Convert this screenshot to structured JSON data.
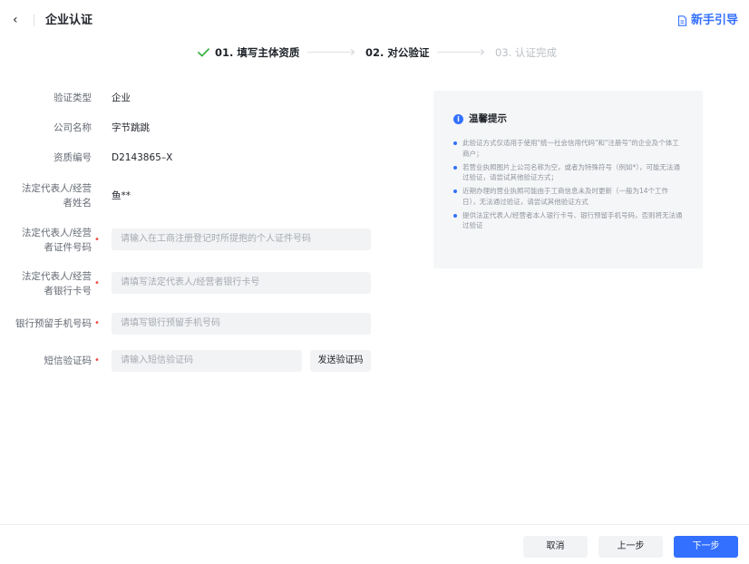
{
  "header": {
    "back_glyph": "‹",
    "title": "企业认证",
    "guide_label": "新手引导"
  },
  "steps": [
    {
      "label": "01. 填写主体资质",
      "state": "done"
    },
    {
      "label": "02. 对公验证",
      "state": "active"
    },
    {
      "label": "03. 认证完成",
      "state": "pending"
    }
  ],
  "form": {
    "verify_type": {
      "label": "验证类型",
      "value": "企业"
    },
    "company_name": {
      "label": "公司名称",
      "value": "字节跳跳"
    },
    "qualification_no": {
      "label": "资质编号",
      "value": "D2143865–X"
    },
    "legal_name": {
      "label_line1": "法定代表人/经营",
      "label_line2": "者姓名",
      "value": "鱼**"
    },
    "legal_id": {
      "label_line1": "法定代表人/经营",
      "label_line2": "者证件号码",
      "placeholder": "请输入在工商注册登记时所提抱的个人证件号码"
    },
    "legal_bank": {
      "label_line1": "法定代表人/经营",
      "label_line2": "者银行卡号",
      "placeholder": "请填写法定代表人/经营者银行卡号"
    },
    "bank_phone": {
      "label": "银行预留手机号码",
      "placeholder": "请填写银行预留手机号码"
    },
    "sms_code": {
      "label": "短信验证码",
      "placeholder": "请输入短信验证码",
      "send_label": "发送验证码"
    },
    "required_mark": "•"
  },
  "tips": {
    "title": "温馨提示",
    "items": [
      "此验证方式仅适用于使用\"统一社会信用代码\"和\"注册号\"的企业及个体工商户；",
      "若营业执照图片上公司名称为空，或者为特殊符号（例如*），可能无法通过验证，请尝试其他验证方式；",
      "近期办理的营业执照可能由于工商信息未及时更新（一般为14个工作日），无法通过验证，请尝试其他验证方式",
      "提供法定代表人/经营者本人银行卡号、银行预留手机号码，否则将无法通过验证"
    ]
  },
  "footer": {
    "cancel_label": "取消",
    "prev_label": "上一步",
    "next_label": "下一步"
  },
  "colors": {
    "accent": "#3370ff",
    "success": "#3bb346",
    "required": "#f54a45"
  }
}
